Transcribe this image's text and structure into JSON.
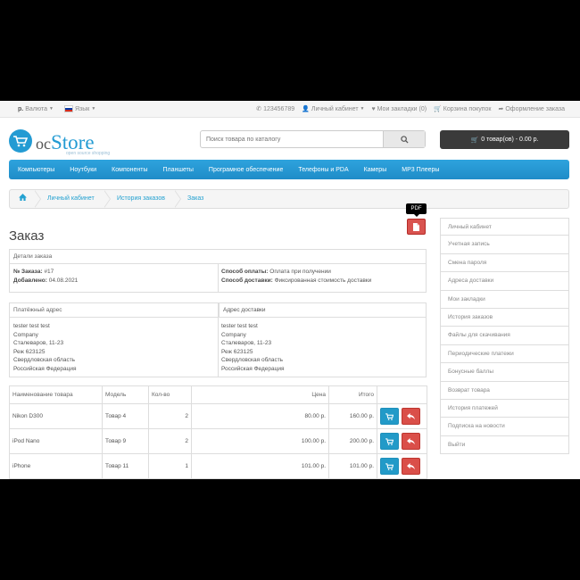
{
  "topbar": {
    "currency_symbol": "р.",
    "currency_label": "Валюта",
    "language_label": "Язык",
    "phone": "123456789",
    "account": "Личный кабинет",
    "wishlist": "Мои закладки (0)",
    "cart": "Корзина покупок",
    "checkout": "Оформление заказа"
  },
  "logo": {
    "prefix": "oc",
    "name": "Store",
    "tagline": "open source shopping"
  },
  "search": {
    "placeholder": "Поиск товара по каталогу"
  },
  "cart_button": "0 товар(ов) - 0.00 р.",
  "menu": [
    "Компьютеры",
    "Ноутбуки",
    "Компоненты",
    "Планшеты",
    "Програмное обеспечение",
    "Телефоны и PDA",
    "Камеры",
    "MP3 Плееры"
  ],
  "breadcrumb": [
    "Личный кабинет",
    "История заказов",
    "Заказ"
  ],
  "pdf_tooltip": "PDF",
  "page_title": "Заказ",
  "details": {
    "header": "Детали заказа",
    "order_label": "№ Заказа:",
    "order_value": "#17",
    "added_label": "Добавлено:",
    "added_value": "04.08.2021",
    "payment_label": "Способ оплаты:",
    "payment_value": "Оплата при получении",
    "shipping_label": "Способ доставки:",
    "shipping_value": "Фиксированная стоимость доставки"
  },
  "addresses": {
    "payment_header": "Платёжный адрес",
    "shipping_header": "Адрес доставки",
    "payment": [
      "tester test test",
      "Company",
      "Сталеваров, 11-23",
      "Реж 623125",
      "Свердловская область",
      "Российская Федерация"
    ],
    "shipping": [
      "tester test test",
      "Company",
      "Сталеваров, 11-23",
      "Реж 623125",
      "Свердловская область",
      "Российская Федерация"
    ]
  },
  "products": {
    "headers": [
      "Наименование товара",
      "Модель",
      "Кол-во",
      "Цена",
      "Итого"
    ],
    "rows": [
      {
        "name": "Nikon D300",
        "model": "Товар 4",
        "qty": "2",
        "price": "80.00 р.",
        "total": "160.00 р."
      },
      {
        "name": "iPod Nano",
        "model": "Товар 9",
        "qty": "2",
        "price": "100.00 р.",
        "total": "200.00 р."
      },
      {
        "name": "iPhone",
        "model": "Товар 11",
        "qty": "1",
        "price": "101.00 р.",
        "total": "101.00 р."
      }
    ]
  },
  "sidebar": [
    "Личный кабинет",
    "Учетная запись",
    "Смена пароля",
    "Адреса доставки",
    "Мои закладки",
    "История заказов",
    "Файлы для скачивания",
    "Периодические платежи",
    "Бонусные баллы",
    "Возврат товара",
    "История платежей",
    "Подписка на новости",
    "Выйти"
  ],
  "colors": {
    "accent": "#239bd3",
    "danger": "#da4f49",
    "dark": "#3a3a3a"
  }
}
